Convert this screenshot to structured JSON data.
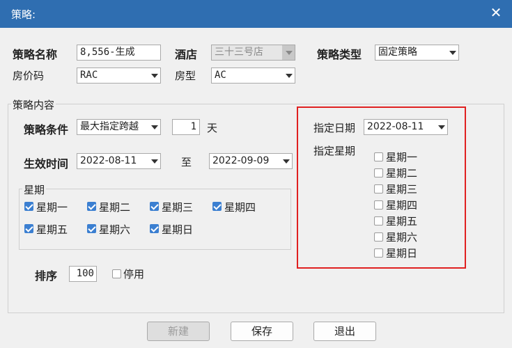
{
  "window": {
    "title": "策略:"
  },
  "top": {
    "name_label": "策略名称",
    "name_value": "8,556-生成",
    "hotel_label": "酒店",
    "hotel_value": "三十三号店",
    "type_label": "策略类型",
    "type_value": "固定策略",
    "rate_code_label": "房价码",
    "rate_code_value": "RAC",
    "room_type_label": "房型",
    "room_type_value": "AC"
  },
  "content": {
    "legend": "策略内容",
    "condition_label": "策略条件",
    "condition_value": "最大指定跨越",
    "days_value": "1",
    "days_unit": "天",
    "effective_label": "生效时间",
    "start_date": "2022-08-11",
    "to_label": "至",
    "end_date": "2022-09-09",
    "weekday_legend": "星期",
    "weekdays": [
      {
        "label": "星期一",
        "checked": true
      },
      {
        "label": "星期二",
        "checked": true
      },
      {
        "label": "星期三",
        "checked": true
      },
      {
        "label": "星期四",
        "checked": true
      },
      {
        "label": "星期五",
        "checked": true
      },
      {
        "label": "星期六",
        "checked": true
      },
      {
        "label": "星期日",
        "checked": true
      }
    ],
    "sort_label": "排序",
    "sort_value": "100",
    "disable_label": "停用",
    "disable_checked": false
  },
  "specified": {
    "date_label": "指定日期",
    "date_value": "2022-08-11",
    "weekday_label": "指定星期",
    "weekdays": [
      {
        "label": "星期一",
        "checked": false
      },
      {
        "label": "星期二",
        "checked": false
      },
      {
        "label": "星期三",
        "checked": false
      },
      {
        "label": "星期四",
        "checked": false
      },
      {
        "label": "星期五",
        "checked": false
      },
      {
        "label": "星期六",
        "checked": false
      },
      {
        "label": "星期日",
        "checked": false
      }
    ],
    "highlight_color": "#e02020"
  },
  "buttons": {
    "new": "新建",
    "save": "保存",
    "exit": "退出"
  },
  "colors": {
    "titlebar": "#2f6eb1",
    "checkbox_checked": "#3b7fd1"
  }
}
